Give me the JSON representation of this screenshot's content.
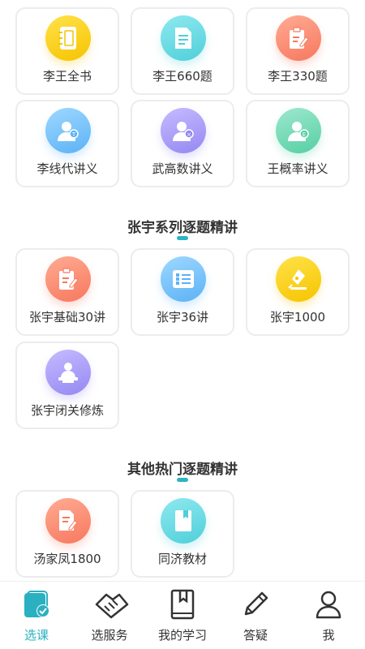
{
  "grid_top": {
    "items": [
      {
        "label": "李王全书",
        "icon": "notebook-icon",
        "color": "#f6c400"
      },
      {
        "label": "李王660题",
        "icon": "document-icon",
        "color": "#4fcfda"
      },
      {
        "label": "李王330题",
        "icon": "clipboard-edit-icon",
        "color": "#f7785e"
      },
      {
        "label": "李线代讲义",
        "icon": "teacher-avatar-icon",
        "color": "#5cb2f6"
      },
      {
        "label": "武高数讲义",
        "icon": "teacher-avatar-icon",
        "color": "#9488f2"
      },
      {
        "label": "王概率讲义",
        "icon": "teacher-avatar-icon",
        "color": "#55cfa3"
      }
    ]
  },
  "section_zhangyu": {
    "title": "张宇系列逐题精讲",
    "items": [
      {
        "label": "张宇基础30讲",
        "icon": "clipboard-edit-icon",
        "color": "#f7785e"
      },
      {
        "label": "张宇36讲",
        "icon": "list-icon",
        "color": "#5cb2f6"
      },
      {
        "label": "张宇1000",
        "icon": "pen-nib-icon",
        "color": "#f6c400"
      },
      {
        "label": "张宇闭关修炼",
        "icon": "lecturer-podium-icon",
        "color": "#9488f2"
      }
    ]
  },
  "section_other": {
    "title": "其他热门逐题精讲",
    "items": [
      {
        "label": "汤家凤1800",
        "icon": "document-edit-icon",
        "color": "#f7785e"
      },
      {
        "label": "同济教材",
        "icon": "book-icon",
        "color": "#4fcfda"
      }
    ]
  },
  "tabbar": {
    "items": [
      {
        "label": "选课",
        "icon": "courses-icon",
        "active": true
      },
      {
        "label": "选服务",
        "icon": "handshake-icon",
        "active": false
      },
      {
        "label": "我的学习",
        "icon": "bookmark-book-icon",
        "active": false
      },
      {
        "label": "答疑",
        "icon": "pencil-icon",
        "active": false
      },
      {
        "label": "我",
        "icon": "person-icon",
        "active": false
      }
    ],
    "active_color": "#2ab0c0"
  }
}
